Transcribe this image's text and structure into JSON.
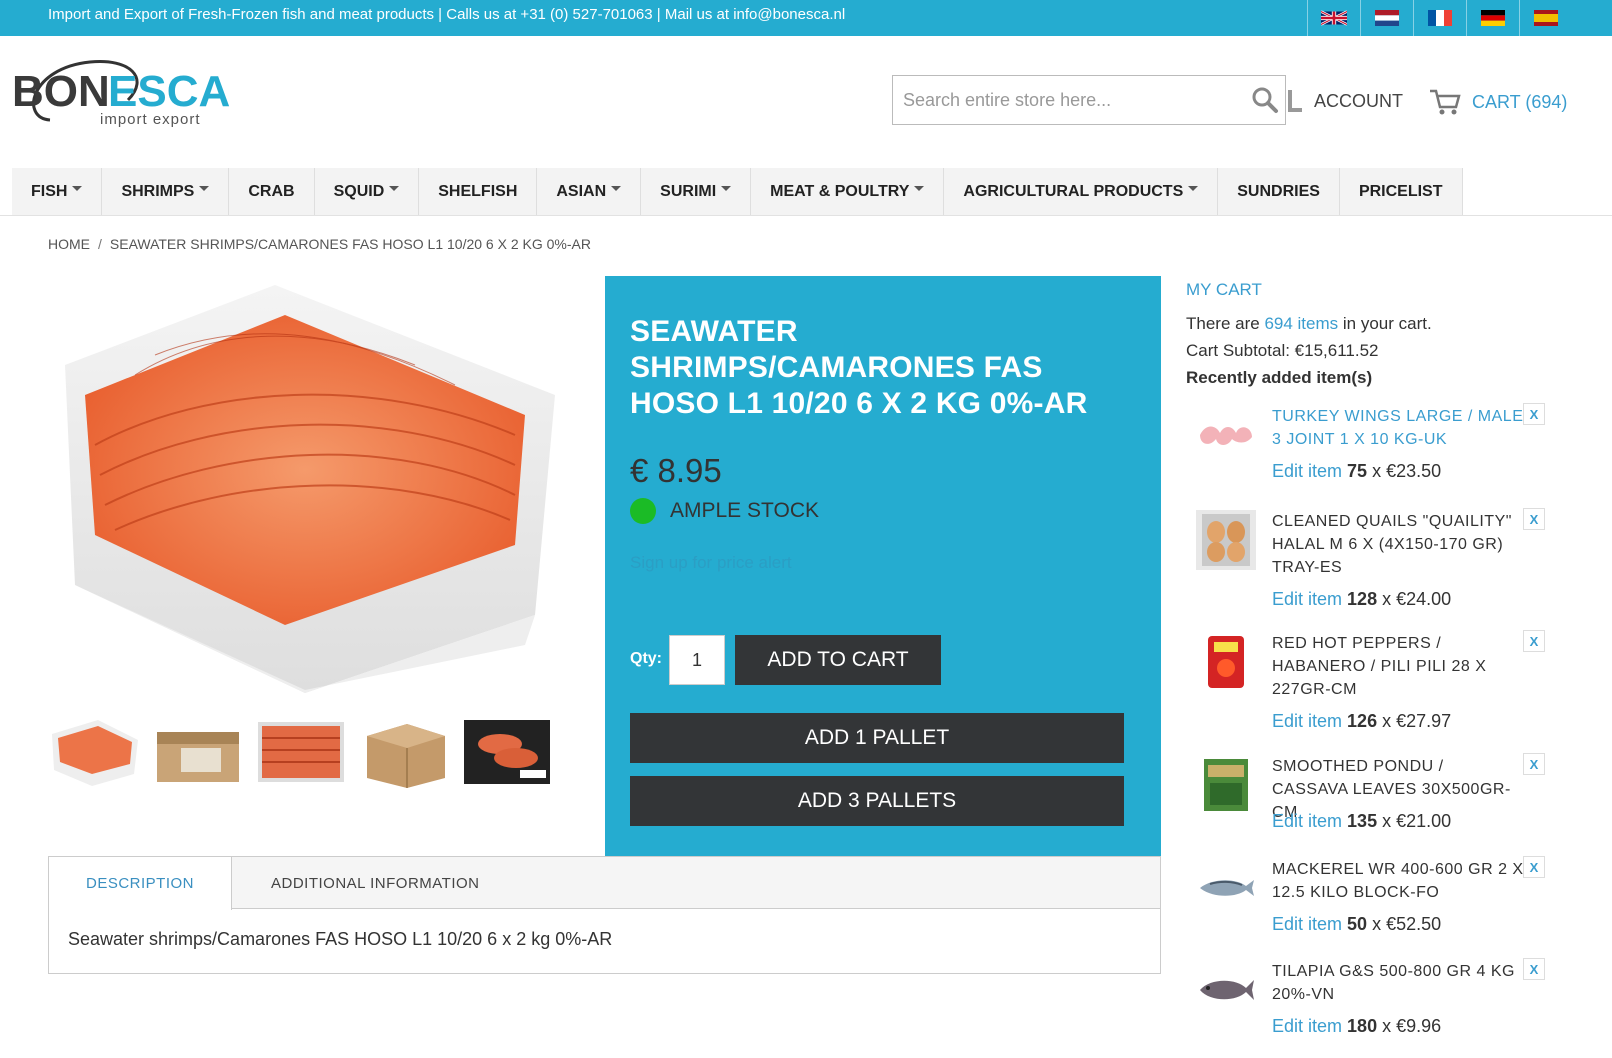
{
  "topbar": {
    "text": "Import and Export of Fresh-Frozen fish and meat products  |  Calls us at +31 (0) 527-701063  |  Mail us at info@bonesca.nl"
  },
  "logo": {
    "brand_dark": "BON",
    "brand_blue": "ESCA",
    "tagline": "import export"
  },
  "search": {
    "placeholder": "Search entire store here..."
  },
  "header": {
    "account_label": "ACCOUNT",
    "cart_label": "CART (694)"
  },
  "nav": [
    {
      "label": "FISH",
      "dropdown": true
    },
    {
      "label": "SHRIMPS",
      "dropdown": true
    },
    {
      "label": "CRAB",
      "dropdown": false
    },
    {
      "label": "SQUID",
      "dropdown": true
    },
    {
      "label": "SHELFISH",
      "dropdown": false
    },
    {
      "label": "ASIAN",
      "dropdown": true
    },
    {
      "label": "SURIMI",
      "dropdown": true
    },
    {
      "label": "MEAT & POULTRY",
      "dropdown": true
    },
    {
      "label": "AGRICULTURAL PRODUCTS",
      "dropdown": true
    },
    {
      "label": "SUNDRIES",
      "dropdown": false
    },
    {
      "label": "PRICELIST",
      "dropdown": false
    }
  ],
  "breadcrumb": {
    "home": "HOME",
    "separator": "/",
    "current": "SEAWATER SHRIMPS/CAMARONES FAS HOSO L1 10/20 6 X 2 KG 0%-AR"
  },
  "product": {
    "title": "SEAWATER SHRIMPS/CAMARONES FAS HOSO L1 10/20 6 X 2 KG 0%-AR",
    "price": "€ 8.95",
    "stock": "AMPLE STOCK",
    "price_alert": "Sign up for price alert",
    "qty_label": "Qty:",
    "qty_value": "1",
    "add_to_cart": "ADD TO CART",
    "add_pallet_1": "ADD 1 PALLET",
    "add_pallet_3": "ADD 3 PALLETS",
    "colors": {
      "panel": "#25acd0",
      "button": "#333537",
      "stock": "#1bbb26"
    }
  },
  "tabs": {
    "description_tab": "DESCRIPTION",
    "additional_tab": "ADDITIONAL INFORMATION",
    "description_text": "Seawater shrimps/Camarones FAS HOSO L1 10/20 6 x 2 kg 0%-AR"
  },
  "sidebar_cart": {
    "title": "MY CART",
    "there_are": "There are ",
    "items_link": "694 items",
    "in_your_cart": " in your cart.",
    "subtotal": "Cart Subtotal: €15,611.52",
    "recent": "Recently added item(s)",
    "edit_label": "Edit item",
    "remove_label": "X",
    "items": [
      {
        "name": "TURKEY WINGS LARGE / MALE 3 JOINT 1 X 10 KG-UK",
        "qty": "75",
        "price": "x €23.50",
        "icon": "turkey-wings"
      },
      {
        "name": "CLEANED QUAILS \"QUAILITY\" HALAL M 6 X (4X150-170 GR) TRAY-ES",
        "qty": "128",
        "price": "x €24.00",
        "icon": "quails"
      },
      {
        "name": "RED HOT PEPPERS / HABANERO / PILI PILI 28 X 227GR-CM",
        "qty": "126",
        "price": "x €27.97",
        "icon": "peppers"
      },
      {
        "name": "SMOOTHED PONDU / CASSAVA LEAVES 30X500GR-CM",
        "qty": "135",
        "price": "x €21.00",
        "icon": "pondu"
      },
      {
        "name": "MACKEREL WR 400-600 GR 2 X 12.5 KILO BLOCK-FO",
        "qty": "50",
        "price": "x €52.50",
        "icon": "mackerel"
      },
      {
        "name": "TILAPIA G&S 500-800 GR 4 KG 20%-VN",
        "qty": "180",
        "price": "x €9.96",
        "icon": "tilapia"
      }
    ]
  }
}
